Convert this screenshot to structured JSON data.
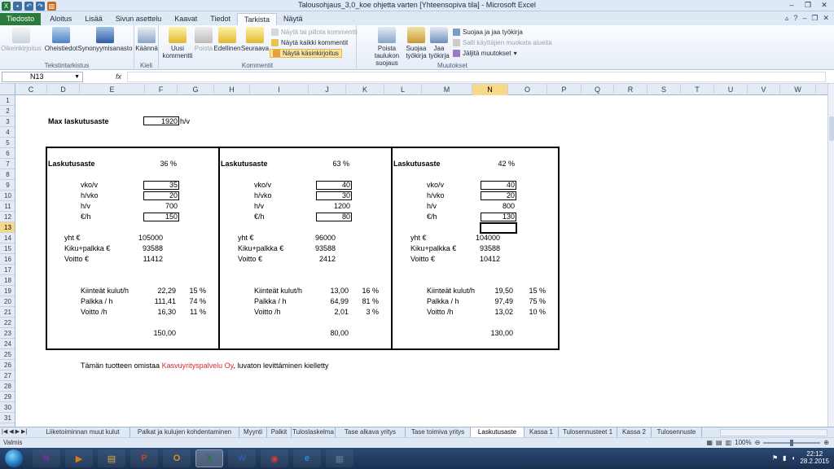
{
  "window": {
    "title": "Talousohjaus_3,0_koe ohjetta varten  [Yhteensopiva tila]  -  Microsoft Excel"
  },
  "ribbon_tabs": [
    {
      "label": "Tiedosto",
      "kind": "file"
    },
    {
      "label": "Aloitus"
    },
    {
      "label": "Lisää"
    },
    {
      "label": "Sivun asettelu"
    },
    {
      "label": "Kaavat"
    },
    {
      "label": "Tiedot"
    },
    {
      "label": "Tarkista",
      "kind": "active"
    },
    {
      "label": "Näytä"
    }
  ],
  "ribbon": {
    "text_review": {
      "label": "Tekstintarkistus",
      "spelling": "Oikeinkirjoitus",
      "research": "Oheistiedot",
      "thesaurus": "Synonyymisanasto"
    },
    "language": {
      "label": "Kieli",
      "translate": "Käännä"
    },
    "comments": {
      "label": "Kommentit",
      "new_comment": "Uusi kommentti",
      "delete": "Poista",
      "previous": "Edellinen",
      "next": "Seuraava",
      "show_hide": "Näytä tai piilota kommentti",
      "show_all": "Näytä kaikki kommentit",
      "show_ink": "Näytä käsinkirjoitus"
    },
    "changes": {
      "label": "Muutokset",
      "unprotect_sheet": "Poista taulukon suojaus",
      "protect_workbook": "Suojaa työkirja",
      "share_workbook": "Jaa työkirja",
      "protect_and_share": "Suojaa ja jaa työkirja",
      "allow_users_edit": "Salli käyttäjien muokata alueita",
      "track_changes": "Jäljitä muutokset"
    }
  },
  "formula_bar": {
    "name_box": "N13",
    "fx": "fx",
    "formula": ""
  },
  "columns": [
    "C",
    "D",
    "E",
    "F",
    "G",
    "H",
    "I",
    "J",
    "K",
    "L",
    "M",
    "N",
    "O",
    "P",
    "Q",
    "R",
    "S",
    "T",
    "U",
    "V",
    "W"
  ],
  "selected_column": "N",
  "rows": [
    "1",
    "2",
    "3",
    "4",
    "5",
    "6",
    "7",
    "8",
    "9",
    "10",
    "11",
    "12",
    "13",
    "14",
    "15",
    "16",
    "17",
    "18",
    "19",
    "20",
    "21",
    "22",
    "23",
    "24",
    "25",
    "26",
    "27",
    "28",
    "29",
    "30",
    "31"
  ],
  "selected_row": "13",
  "sheet": {
    "max_label": "Max laskutusaste",
    "max_value": "1920",
    "max_unit": "h/v",
    "blocks": [
      {
        "title": "Laskutusaste",
        "rate": "36 %",
        "vko_label": "vko/v",
        "vko": "35",
        "hvko_label": "h/vko",
        "hvko": "20",
        "hv_label": "h/v",
        "hv": "700",
        "eur_label": "€/h",
        "eur": "150",
        "yht_label": "yht €",
        "yht": "105000",
        "kiku_label": "Kiku+palkka €",
        "kiku": "93588",
        "voitto_label": "Voitto €",
        "voitto": "11412",
        "kk_label": "Kiinteät kulut/h",
        "kk": "22,29",
        "kk_pct": "15 %",
        "palkka_label": "Palkka / h",
        "palkka": "111,41",
        "palkka_pct": "74 %",
        "vh_label": "Voitto /h",
        "vh": "16,30",
        "vh_pct": "11 %",
        "total": "150,00"
      },
      {
        "title": "Laskutusaste",
        "rate": "63 %",
        "vko_label": "vko/v",
        "vko": "40",
        "hvko_label": "h/vko",
        "hvko": "30",
        "hv_label": "h/v",
        "hv": "1200",
        "eur_label": "€/h",
        "eur": "80",
        "yht_label": "yht €",
        "yht": "96000",
        "kiku_label": "Kiku+palkka €",
        "kiku": "93588",
        "voitto_label": "Voitto €",
        "voitto": "2412",
        "kk_label": "Kiinteät kulut/h",
        "kk": "13,00",
        "kk_pct": "16 %",
        "palkka_label": "Palkka / h",
        "palkka": "64,99",
        "palkka_pct": "81 %",
        "vh_label": "Voitto /h",
        "vh": "2,01",
        "vh_pct": "3 %",
        "total": "80,00"
      },
      {
        "title": "Laskutusaste",
        "rate": "42 %",
        "vko_label": "vko/v",
        "vko": "40",
        "hvko_label": "h/vko",
        "hvko": "20",
        "hv_label": "h/v",
        "hv": "800",
        "eur_label": "€/h",
        "eur": "130",
        "yht_label": "yht €",
        "yht": "104000",
        "kiku_label": "Kiku+palkka €",
        "kiku": "93588",
        "voitto_label": "Voitto €",
        "voitto": "10412",
        "kk_label": "Kiinteät kulut/h",
        "kk": "19,50",
        "kk_pct": "15 %",
        "palkka_label": "Palkka / h",
        "palkka": "97,49",
        "palkka_pct": "75 %",
        "vh_label": "Voitto /h",
        "vh": "13,02",
        "vh_pct": "10 %",
        "total": "130,00"
      }
    ],
    "notice_pre": "Tämän tuotteen omistaa ",
    "notice_company": "Kasvuyrityspalvelu Oy",
    "notice_post": ", luvaton levittäminen kielletty",
    "accent_red": "#e0282b"
  },
  "sheet_tabs": [
    {
      "label": "Liiketoiminnan muut kulut"
    },
    {
      "label": "Palkat ja kulujen kohdentaminen"
    },
    {
      "label": "Myynti"
    },
    {
      "label": "Palkit"
    },
    {
      "label": "Tuloslaskelma"
    },
    {
      "label": "Tase alkava yritys"
    },
    {
      "label": "Tase toimiva yritys"
    },
    {
      "label": "Laskutusaste",
      "active": true
    },
    {
      "label": "Kassa 1"
    },
    {
      "label": "Tulosennusteet 1"
    },
    {
      "label": "Kassa 2"
    },
    {
      "label": "Tulosennuste"
    }
  ],
  "status": {
    "mode": "Valmis",
    "zoom": "100%"
  },
  "taskbar": {
    "apps": [
      {
        "icon": "onenote-icon",
        "glyph": "N",
        "color": "#7b2f9a"
      },
      {
        "icon": "media-player-icon",
        "glyph": "▶",
        "color": "#e07a10"
      },
      {
        "icon": "explorer-folder-icon",
        "glyph": "▤",
        "color": "#d9a93a"
      },
      {
        "icon": "powerpoint-icon",
        "glyph": "P",
        "color": "#c8481f"
      },
      {
        "icon": "outlook-icon",
        "glyph": "O",
        "color": "#e68a1c"
      },
      {
        "icon": "excel-icon",
        "glyph": "X",
        "color": "#1f7a3a",
        "active": true
      },
      {
        "icon": "word-icon",
        "glyph": "W",
        "color": "#2a5fa8"
      },
      {
        "icon": "chrome-icon",
        "glyph": "◉",
        "color": "#d93b2f"
      },
      {
        "icon": "internet-explorer-icon",
        "glyph": "e",
        "color": "#2a8fd8"
      },
      {
        "icon": "calculator-icon",
        "glyph": "▦",
        "color": "#5a7a9a"
      }
    ],
    "time": "22:12",
    "date": "28.2.2015"
  }
}
